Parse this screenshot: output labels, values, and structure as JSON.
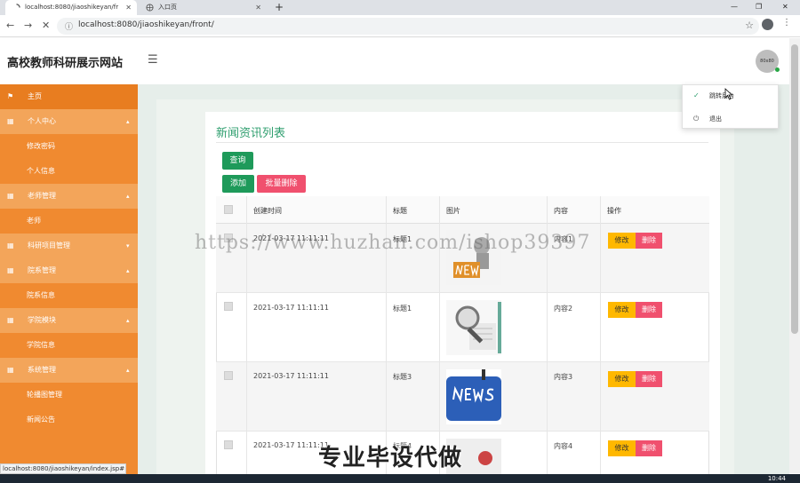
{
  "browser": {
    "active_tab": "localhost:8080/jiaoshikeyan/fr",
    "inactive_tab": "入口页",
    "url": "localhost:8080/jiaoshikeyan/front/",
    "status_url": "localhost:8080/jiaoshikeyan/index.jsp#"
  },
  "header": {
    "site_title": "高校教师科研展示网站",
    "avatar_text": "80x80"
  },
  "sidebar": {
    "items": [
      {
        "label": "主页"
      },
      {
        "label": "个人中心"
      },
      {
        "label": "修改密码"
      },
      {
        "label": "个人信息"
      },
      {
        "label": "老师管理"
      },
      {
        "label": "老师"
      },
      {
        "label": "科研项目管理"
      },
      {
        "label": "院系管理"
      },
      {
        "label": "院系信息"
      },
      {
        "label": "学院模块"
      },
      {
        "label": "学院信息"
      },
      {
        "label": "系统管理"
      },
      {
        "label": "轮播图管理"
      },
      {
        "label": "新闻公告"
      }
    ]
  },
  "main": {
    "title": "新闻资讯列表",
    "query_button": "查询",
    "add_button": "添加",
    "batch_delete_button": "批量删除",
    "columns": [
      "创建时间",
      "标题",
      "图片",
      "内容",
      "操作"
    ],
    "rows": [
      {
        "time": "2021-03-17 11:11:11",
        "title": "标题1",
        "content": "内容1"
      },
      {
        "time": "2021-03-17 11:11:11",
        "title": "标题1",
        "content": "内容2"
      },
      {
        "time": "2021-03-17 11:11:11",
        "title": "标题3",
        "content": "内容3"
      },
      {
        "time": "2021-03-17 11:11:11",
        "title": "标题4",
        "content": "内容4"
      }
    ],
    "edit_label": "修改",
    "delete_label": "删除"
  },
  "dropdown": {
    "items": [
      {
        "label": "跳转后台"
      },
      {
        "label": "退出"
      }
    ]
  },
  "watermarks": {
    "url": "https://www.huzhan.com/ishop39397",
    "text": "专业毕设代做"
  },
  "taskbar": {
    "clock": "10:44"
  },
  "colors": {
    "sidebar": "#f08a30",
    "accent": "#2e9e6e",
    "danger": "#f0506e",
    "warning": "#ffb800"
  }
}
